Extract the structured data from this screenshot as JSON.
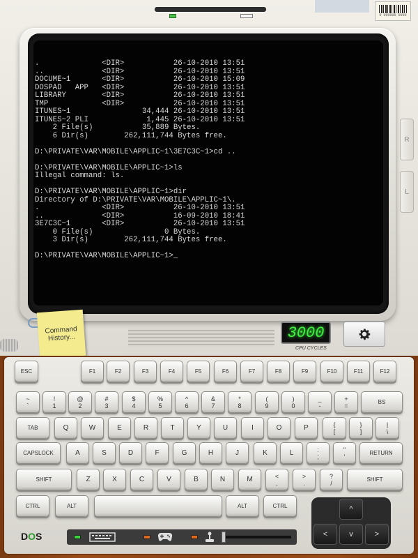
{
  "hardware": {
    "barcode_text": "0 000000 0000",
    "side_buttons": [
      "R",
      "L"
    ],
    "sticky_note": "Command History...",
    "cpu_cycles_value": "3000",
    "cpu_cycles_label": "CPU CYCLES"
  },
  "terminal": {
    "lines": [
      ".              <DIR>           26-10-2010 13:51",
      "..             <DIR>           26-10-2010 13:51",
      "DOCUME~1       <DIR>           26-10-2010 15:09",
      "DOSPAD   APP   <DIR>           26-10-2010 13:51",
      "LIBRARY        <DIR>           26-10-2010 13:51",
      "TMP            <DIR>           26-10-2010 13:51",
      "ITUNES~1                34,444 26-10-2010 13:51",
      "ITUNES~2 PLI             1,445 26-10-2010 13:51",
      "    2 File(s)           35,889 Bytes.",
      "    6 Dir(s)        262,111,744 Bytes free.",
      "",
      "D:\\PRIVATE\\VAR\\MOBILE\\APPLIC~1\\3E7C3C~1>cd ..",
      "",
      "D:\\PRIVATE\\VAR\\MOBILE\\APPLIC~1>ls",
      "Illegal command: ls.",
      "",
      "D:\\PRIVATE\\VAR\\MOBILE\\APPLIC~1>dir",
      "Directory of D:\\PRIVATE\\VAR\\MOBILE\\APPLIC~1\\.",
      ".              <DIR>           26-10-2010 13:51",
      "..             <DIR>           16-09-2010 18:41",
      "3E7C3C~1       <DIR>           26-10-2010 13:51",
      "    0 File(s)                0 Bytes.",
      "    3 Dir(s)        262,111,744 Bytes free.",
      "",
      "D:\\PRIVATE\\VAR\\MOBILE\\APPLIC~1>_"
    ]
  },
  "keyboard": {
    "row1": [
      "ESC",
      "F1",
      "F2",
      "F3",
      "F4",
      "F5",
      "F6",
      "F7",
      "F8",
      "F9",
      "F10",
      "F11",
      "F12"
    ],
    "row2_top": [
      "~",
      "!",
      "@",
      "#",
      "$",
      "%",
      "^",
      "&",
      "*",
      "(",
      ")",
      "_",
      "+"
    ],
    "row2_bottom": [
      "`",
      "1",
      "2",
      "3",
      "4",
      "5",
      "6",
      "7",
      "8",
      "9",
      "0",
      "-",
      "="
    ],
    "backspace": "BS",
    "tab": "TAB",
    "row3": [
      "Q",
      "W",
      "E",
      "R",
      "T",
      "Y",
      "U",
      "I",
      "O",
      "P"
    ],
    "row3_sym_top": [
      "{",
      "}",
      "|"
    ],
    "row3_sym_bottom": [
      "[",
      "]",
      "\\"
    ],
    "capslock": "CAPSLOCK",
    "row4": [
      "A",
      "S",
      "D",
      "F",
      "G",
      "H",
      "J",
      "K",
      "L"
    ],
    "row4_sym_top": [
      ":",
      "\""
    ],
    "row4_sym_bottom": [
      ";",
      "'"
    ],
    "return": "RETURN",
    "shift": "SHIFT",
    "row5": [
      "Z",
      "X",
      "C",
      "V",
      "B",
      "N",
      "M"
    ],
    "row5_sym_top": [
      "<",
      ">",
      "?"
    ],
    "row5_sym_bottom": [
      ",",
      ".",
      "/"
    ],
    "ctrl": "CTRL",
    "alt": "ALT",
    "arrows": {
      "up": "^",
      "left": "<",
      "down": "v",
      "right": ">"
    }
  },
  "status_bar": {
    "logo_prefix": "D",
    "logo_o": "O",
    "logo_suffix": "S",
    "led_colors": [
      "#3bd43b",
      "#e06a1a",
      "#e06a1a"
    ],
    "icons": [
      "keyboard-icon",
      "gamepad-icon",
      "joystick-icon"
    ]
  }
}
